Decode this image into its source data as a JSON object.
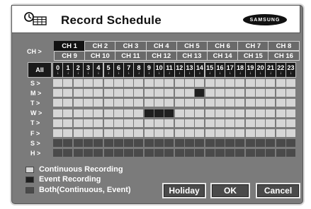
{
  "window": {
    "title": "Record Schedule",
    "brand": "SAMSUNG"
  },
  "channels": {
    "label": "CH >",
    "row1": [
      "CH 1",
      "CH 2",
      "CH 3",
      "CH 4",
      "CH 5",
      "CH 6",
      "CH 7",
      "CH 8"
    ],
    "row2": [
      "CH 9",
      "CH 10",
      "CH 11",
      "CH 12",
      "CH 13",
      "CH 14",
      "CH 15",
      "CH 16"
    ],
    "selected": "CH 1"
  },
  "all_label": "All",
  "hours": [
    "0",
    "1",
    "2",
    "3",
    "4",
    "5",
    "6",
    "7",
    "8",
    "9",
    "10",
    "11",
    "12",
    "13",
    "14",
    "15",
    "16",
    "17",
    "18",
    "19",
    "20",
    "21",
    "22",
    "23"
  ],
  "days": [
    {
      "label": "S >",
      "cells": [
        "c",
        "c",
        "c",
        "c",
        "c",
        "c",
        "c",
        "c",
        "c",
        "c",
        "c",
        "c",
        "c",
        "c",
        "c",
        "c",
        "c",
        "c",
        "c",
        "c",
        "c",
        "c",
        "c",
        "c"
      ]
    },
    {
      "label": "M >",
      "cells": [
        "c",
        "c",
        "c",
        "c",
        "c",
        "c",
        "c",
        "c",
        "c",
        "c",
        "c",
        "c",
        "c",
        "c",
        "e",
        "c",
        "c",
        "c",
        "c",
        "c",
        "c",
        "c",
        "c",
        "c"
      ]
    },
    {
      "label": "T >",
      "cells": [
        "c",
        "c",
        "c",
        "c",
        "c",
        "c",
        "c",
        "c",
        "c",
        "c",
        "c",
        "c",
        "c",
        "c",
        "c",
        "c",
        "c",
        "c",
        "c",
        "c",
        "c",
        "c",
        "c",
        "c"
      ]
    },
    {
      "label": "W >",
      "cells": [
        "c",
        "c",
        "c",
        "c",
        "c",
        "c",
        "c",
        "c",
        "c",
        "e",
        "e",
        "e",
        "c",
        "c",
        "c",
        "c",
        "c",
        "c",
        "c",
        "c",
        "c",
        "c",
        "c",
        "c"
      ]
    },
    {
      "label": "T >",
      "cells": [
        "c",
        "c",
        "c",
        "c",
        "c",
        "c",
        "c",
        "c",
        "c",
        "c",
        "c",
        "c",
        "c",
        "c",
        "c",
        "c",
        "c",
        "c",
        "c",
        "c",
        "c",
        "c",
        "c",
        "c"
      ]
    },
    {
      "label": "F >",
      "cells": [
        "c",
        "c",
        "c",
        "c",
        "c",
        "c",
        "c",
        "c",
        "c",
        "c",
        "c",
        "c",
        "c",
        "c",
        "c",
        "c",
        "c",
        "c",
        "c",
        "c",
        "c",
        "c",
        "c",
        "c"
      ]
    },
    {
      "label": "S >",
      "cells": [
        "b",
        "b",
        "b",
        "b",
        "b",
        "b",
        "b",
        "b",
        "b",
        "b",
        "b",
        "b",
        "b",
        "b",
        "b",
        "b",
        "b",
        "b",
        "b",
        "b",
        "b",
        "b",
        "b",
        "b"
      ]
    },
    {
      "label": "H >",
      "cells": [
        "b",
        "b",
        "b",
        "b",
        "b",
        "b",
        "b",
        "b",
        "b",
        "b",
        "b",
        "b",
        "b",
        "b",
        "b",
        "b",
        "b",
        "b",
        "b",
        "b",
        "b",
        "b",
        "b",
        "b"
      ]
    }
  ],
  "legend": [
    {
      "label": "Continuous Recording",
      "color": "#d6d6d6"
    },
    {
      "label": "Event Recording",
      "color": "#1f1f1f"
    },
    {
      "label": "Both(Continuous, Event)",
      "color": "#4a4a4a"
    }
  ],
  "buttons": {
    "holiday": "Holiday",
    "ok": "OK",
    "cancel": "Cancel"
  }
}
